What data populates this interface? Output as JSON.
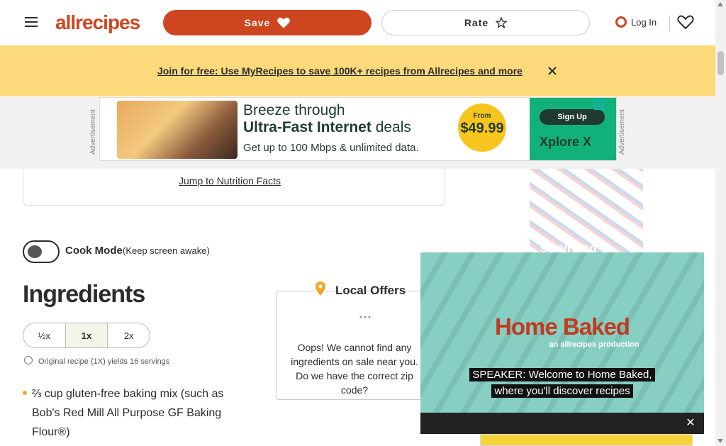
{
  "header": {
    "logo_text": "allrecipes",
    "save_label": "Save",
    "rate_label": "Rate",
    "login_label": "Log In"
  },
  "banner": {
    "link_text": "Join for free: Use MyRecipes to save 100K+ recipes from Allrecipes and more"
  },
  "ad_strip": {
    "label": "Advertisement",
    "line1": "Breeze through",
    "line2_bold": "Ultra-Fast Internet",
    "line2_rest": " deals",
    "line3": "Get up to 100 Mbps & unlimited data.",
    "price_from": "From",
    "price_amount": "$49.99",
    "signup": "Sign Up",
    "brand": "Xplore X"
  },
  "nutrition": {
    "jump_link": "Jump to Nutrition Facts"
  },
  "cook_mode": {
    "label": "Cook Mode",
    "sub": "(Keep screen awake)"
  },
  "ingredients": {
    "title": "Ingredients",
    "scale_options": [
      "½x",
      "1x",
      "2x"
    ],
    "yield_text": "Original recipe (1X) yields 16 servings",
    "items": [
      "⅔ cup gluten-free baking mix (such as Bob's Red Mill All Purpose GF Baking Flour®)"
    ]
  },
  "local_offers": {
    "title": "Local Offers",
    "message": "Oops! We cannot find any ingredients on sale near you. Do we have the correct zip code?"
  },
  "side_ad": {
    "text": "surviving"
  },
  "video": {
    "logo": "Home Baked",
    "logo_sub": "an allrecipes production",
    "caption_line1": "SPEAKER: Welcome to Home Baked,",
    "caption_line2": "where you'll discover recipes"
  },
  "colors": {
    "brand": "#ce4620",
    "banner": "#fcd97a",
    "video_bg": "#87cfc3"
  }
}
